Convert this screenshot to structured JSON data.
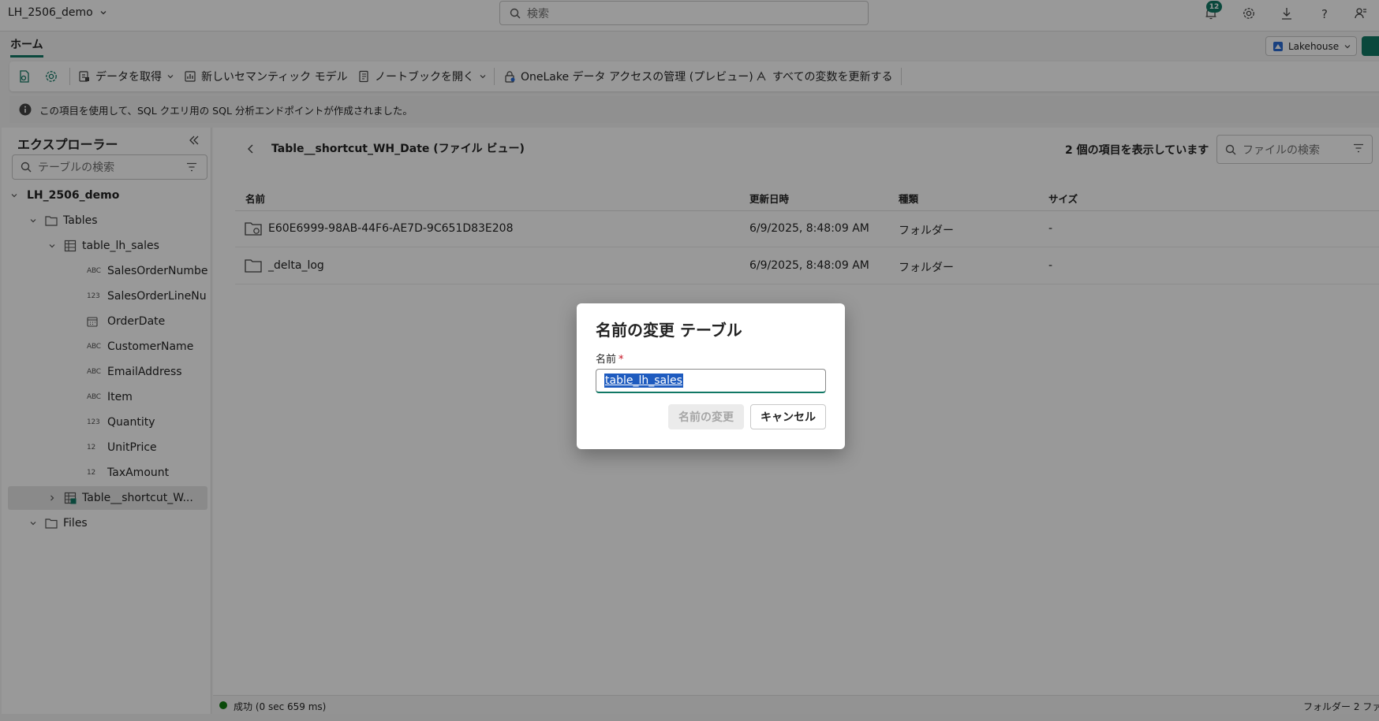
{
  "app": {
    "workspace_title": "LH_2506_demo",
    "search_placeholder": "検索",
    "notification_count": "12"
  },
  "ribbon": {
    "home_tab": "ホーム",
    "lakehouse_label": "Lakehouse",
    "toolbar": {
      "get_data": "データを取得",
      "new_semantic_model": "新しいセマンティック モデル",
      "open_notebook": "ノートブックを開く",
      "onelake_access": "OneLake データ アクセスの管理 (プレビュー)",
      "refresh_variables": "すべての変数を更新する"
    }
  },
  "info_bar": {
    "message": "この項目を使用して、SQL クエリ用の SQL 分析エンドポイントが作成されました。"
  },
  "explorer": {
    "title": "エクスプローラー",
    "search_placeholder": "テーブルの検索",
    "tree": {
      "root": "LH_2506_demo",
      "tables_folder": "Tables",
      "table": "table_lh_sales",
      "columns": [
        {
          "type": "ABC",
          "name": "SalesOrderNumber"
        },
        {
          "type": "123",
          "name": "SalesOrderLineNu..."
        },
        {
          "type": "date",
          "name": "OrderDate"
        },
        {
          "type": "ABC",
          "name": "CustomerName"
        },
        {
          "type": "ABC",
          "name": "EmailAddress"
        },
        {
          "type": "ABC",
          "name": "Item"
        },
        {
          "type": "123",
          "name": "Quantity"
        },
        {
          "type": "12",
          "name": "UnitPrice"
        },
        {
          "type": "12",
          "name": "TaxAmount"
        }
      ],
      "shortcut_table": "Table__shortcut_W...",
      "files_folder": "Files"
    }
  },
  "main": {
    "title": "Table__shortcut_WH_Date (ファイル ビュー)",
    "item_count": "2 個の項目を表示しています",
    "file_search_placeholder": "ファイルの検索",
    "columns": {
      "name": "名前",
      "modified": "更新日時",
      "type": "種類",
      "size": "サイズ"
    },
    "rows": [
      {
        "name": "E60E6999-98AB-44F6-AE7D-9C651D83E208",
        "modified": "6/9/2025, 8:48:09 AM",
        "type": "フォルダー",
        "size": "-"
      },
      {
        "name": "_delta_log",
        "modified": "6/9/2025, 8:48:09 AM",
        "type": "フォルダー",
        "size": "-"
      }
    ]
  },
  "status_bar": {
    "status": "成功 (0 sec 659 ms)",
    "right_text": "フォルダー 2 ファ"
  },
  "dialog": {
    "title": "名前の変更 テーブル",
    "name_label": "名前",
    "required_mark": "*",
    "input_value": "table_lh_sales",
    "rename_button": "名前の変更",
    "cancel_button": "キャンセル"
  },
  "colors": {
    "accent": "#117865",
    "selection": "#1e5bbf",
    "success": "#107c10",
    "required": "#c50f1f"
  }
}
